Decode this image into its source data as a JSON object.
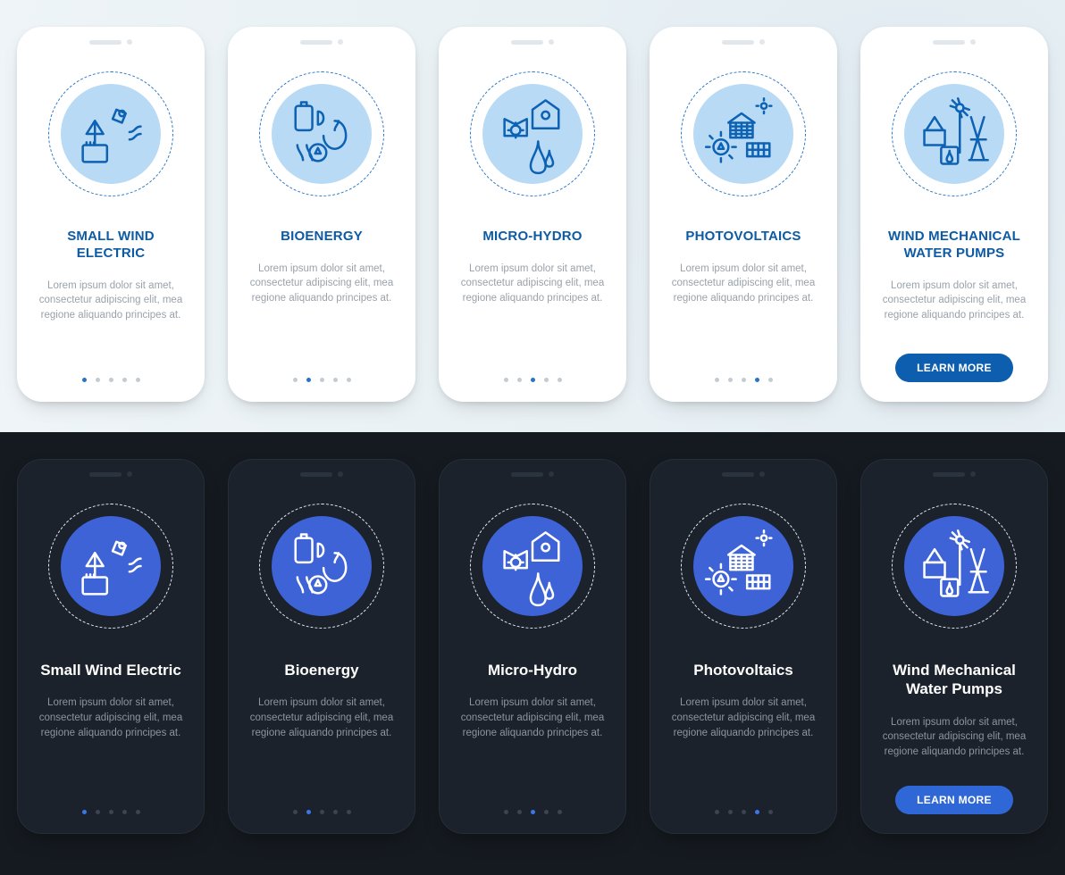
{
  "lorem": "Lorem ipsum dolor sit amet, consectetur adipiscing elit, mea regione aliquando principes at.",
  "button_label": "LEARN MORE",
  "dot_count": 5,
  "light": {
    "cards": [
      {
        "title": "SMALL WIND ELECTRIC",
        "icon": "wind-electric-icon",
        "active_dot": 0
      },
      {
        "title": "BIOENERGY",
        "icon": "bioenergy-icon",
        "active_dot": 1
      },
      {
        "title": "MICRO-HYDRO",
        "icon": "micro-hydro-icon",
        "active_dot": 2
      },
      {
        "title": "PHOTOVOLTAICS",
        "icon": "photovoltaics-icon",
        "active_dot": 3
      },
      {
        "title": "WIND MECHANICAL WATER PUMPS",
        "icon": "wind-pump-icon",
        "has_button": true
      }
    ]
  },
  "dark": {
    "cards": [
      {
        "title": "Small Wind Electric",
        "icon": "wind-electric-icon",
        "active_dot": 0
      },
      {
        "title": "Bioenergy",
        "icon": "bioenergy-icon",
        "active_dot": 1
      },
      {
        "title": "Micro-Hydro",
        "icon": "micro-hydro-icon",
        "active_dot": 2
      },
      {
        "title": "Photovoltaics",
        "icon": "photovoltaics-icon",
        "active_dot": 3
      },
      {
        "title": "Wind Mechanical Water Pumps",
        "icon": "wind-pump-icon",
        "has_button": true
      }
    ]
  }
}
